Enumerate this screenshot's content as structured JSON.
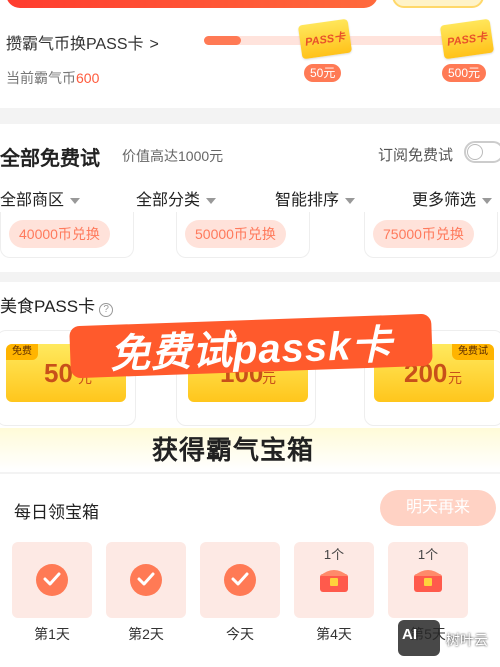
{
  "exchange": {
    "title": "攒霸气币换PASS卡",
    "balance_label": "当前霸气币",
    "balance_value": "600",
    "progress_fraction": 0.13,
    "tier1": {
      "badge": "PASS卡",
      "price": "50元"
    },
    "tier2": {
      "badge": "PASS卡",
      "price": "500元"
    }
  },
  "trial": {
    "title": "全部免费试",
    "subtitle": "价值高达1000元",
    "subscribe_label": "订阅免费试",
    "subscribe_on": false,
    "filters": [
      "全部商区",
      "全部分类",
      "智能排序",
      "更多筛选"
    ],
    "redeem_cards": [
      "40000币兑换",
      "50000币兑换",
      "75000币兑换"
    ]
  },
  "food": {
    "title": "美食PASS卡",
    "coupons": [
      {
        "tag": "免费",
        "amount": "50",
        "unit": "元"
      },
      {
        "tag": "",
        "amount": "100",
        "unit": "元"
      },
      {
        "tag": "免费试",
        "amount": "200",
        "unit": "元"
      }
    ],
    "banner": "免费试passk卡",
    "treasure_text": "获得霸气宝箱"
  },
  "daily": {
    "title": "每日领宝箱",
    "button": "明天再来",
    "days": [
      {
        "label": "第1天",
        "state": "done",
        "count": ""
      },
      {
        "label": "第2天",
        "state": "done",
        "count": ""
      },
      {
        "label": "今天",
        "state": "done",
        "count": ""
      },
      {
        "label": "第4天",
        "state": "chest",
        "count": "1个"
      },
      {
        "label": "第5天",
        "state": "chest",
        "count": "1个"
      }
    ]
  },
  "watermark": {
    "logo": "AI",
    "name": "树叶云"
  },
  "colors": {
    "accent": "#ff7a55",
    "banner": "#ff5a2c",
    "coupon": "#ffc61c"
  }
}
